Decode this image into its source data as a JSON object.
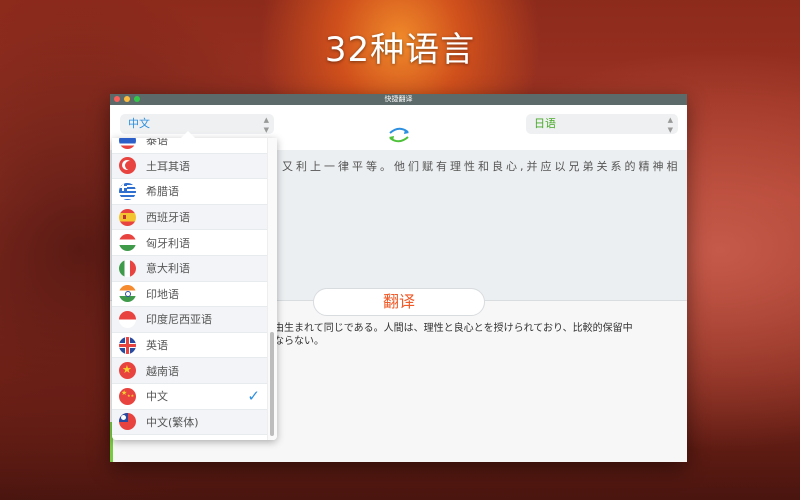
{
  "headline": "32种语言",
  "window": {
    "title": "快捷翻译",
    "traffic_lights": [
      "#fc605c",
      "#fdbc40",
      "#34c84a"
    ]
  },
  "toolbar": {
    "source_language": "中文",
    "target_language": "日语",
    "swap_icon": "swap-arrows-icon",
    "select_arrows": "⇕"
  },
  "source": {
    "text": "又利上一律平等。他们赋有理性和良心,并应以兄弟关系的精神相"
  },
  "translate_button": "翻译",
  "result": {
    "lines": [
      "由生まれて同じである。人間は、理性と良心とを授けられており、比較的保留中",
      "ならない。"
    ]
  },
  "dropdown": {
    "selected": "中文",
    "items": [
      {
        "label": "泰语",
        "flag": "thailand"
      },
      {
        "label": "土耳其语",
        "flag": "turkey"
      },
      {
        "label": "希腊语",
        "flag": "greece"
      },
      {
        "label": "西班牙语",
        "flag": "spain"
      },
      {
        "label": "匈牙利语",
        "flag": "hungary"
      },
      {
        "label": "意大利语",
        "flag": "italy"
      },
      {
        "label": "印地语",
        "flag": "india"
      },
      {
        "label": "印度尼西亚语",
        "flag": "indonesia"
      },
      {
        "label": "英语",
        "flag": "uk"
      },
      {
        "label": "越南语",
        "flag": "vietnam"
      },
      {
        "label": "中文",
        "flag": "china",
        "checked": true
      },
      {
        "label": "中文(繁体)",
        "flag": "taiwan"
      }
    ]
  },
  "colors": {
    "accent_blue": "#2d8fe0",
    "accent_green": "#4aaa2a",
    "translate_orange": "#f05a28"
  }
}
